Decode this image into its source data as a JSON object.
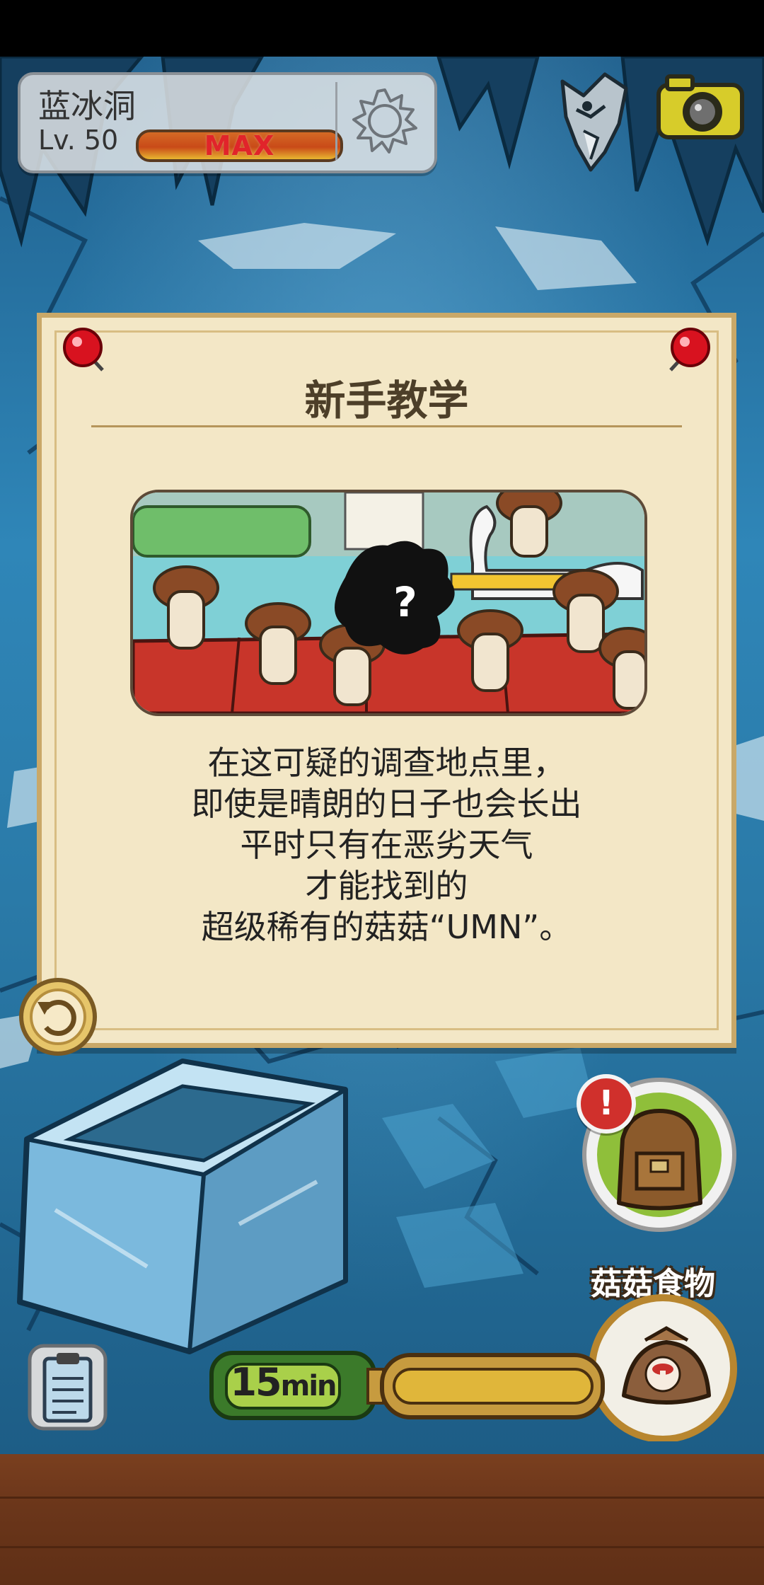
{
  "location": {
    "name": "蓝冰洞",
    "level": "Lv. 50",
    "level_status": "MAX",
    "weather_icon": "sun-icon"
  },
  "tutorial": {
    "title": "新手教学",
    "lines": [
      "在这可疑的调查地点里，",
      "即使是晴朗的日子也会长出",
      "平时只有在恶劣天气",
      "才能找到的",
      "超级稀有的菇菇“UMN”。"
    ],
    "mystery_mark": "?"
  },
  "timer": {
    "value": "15",
    "unit": "min"
  },
  "buttons": {
    "food_label": "菇菇食物",
    "alert_mark": "!"
  },
  "colors": {
    "card_bg": "#f3e7c6",
    "card_border": "#c9a868",
    "cave_blue": "#2f86b8",
    "floor": "#6b361a",
    "alert_red": "#d0302c"
  }
}
